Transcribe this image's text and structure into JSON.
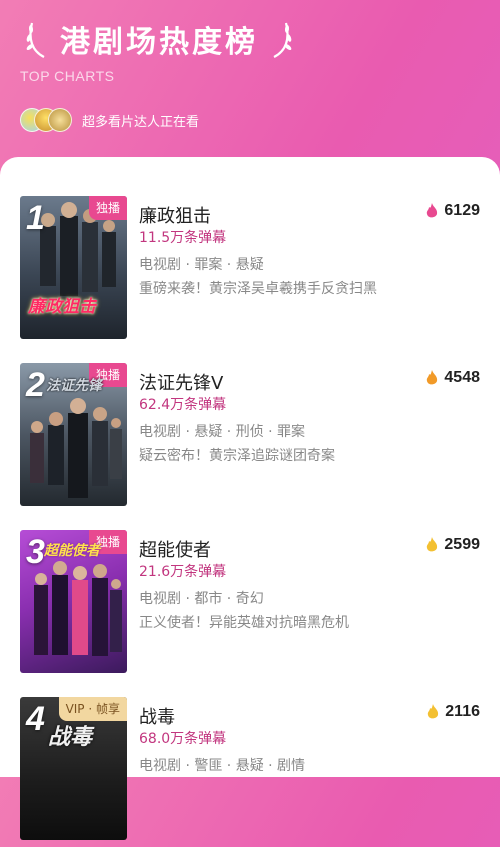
{
  "header": {
    "title": "港剧场热度榜",
    "subtitle": "TOP CHARTS",
    "viewers_text": "超多看片达人正在看"
  },
  "colors": {
    "accent": "#c2367f",
    "exclusive_badge": "#e84990",
    "flame_hot": "#e84990",
    "flame_warm": "#f19a28",
    "flame_mild": "#f3c032"
  },
  "items": [
    {
      "rank": "1",
      "badge": "独播",
      "name": "廉政狙击",
      "danmu": "11.5万条弹幕",
      "tags": "电视剧 · 罪案 · 悬疑",
      "desc": "重磅来袭！黄宗泽吴卓羲携手反贪扫黑",
      "heat": "6129",
      "flame_icon": "flame-icon",
      "poster_logo": "廉政狙击"
    },
    {
      "rank": "2",
      "badge": "独播",
      "name": "法证先锋Ⅴ",
      "danmu": "62.4万条弹幕",
      "tags": "电视剧 · 悬疑 · 刑侦 · 罪案",
      "desc": "疑云密布！黄宗泽追踪谜团奇案",
      "heat": "4548",
      "flame_icon": "flame-icon",
      "poster_logo": "法证先锋"
    },
    {
      "rank": "3",
      "badge": "独播",
      "name": "超能使者",
      "danmu": "21.6万条弹幕",
      "tags": "电视剧 · 都市 · 奇幻",
      "desc": "正义使者！异能英雄对抗暗黑危机",
      "heat": "2599",
      "flame_icon": "flame-icon",
      "poster_logo": "超能使者"
    },
    {
      "rank": "4",
      "badge": "VIP · 帧享",
      "name": "战毒",
      "danmu": "68.0万条弹幕",
      "tags": "电视剧 · 警匪 · 悬疑 · 剧情",
      "desc": "",
      "heat": "2116",
      "flame_icon": "flame-icon",
      "poster_logo": "战毒"
    }
  ]
}
